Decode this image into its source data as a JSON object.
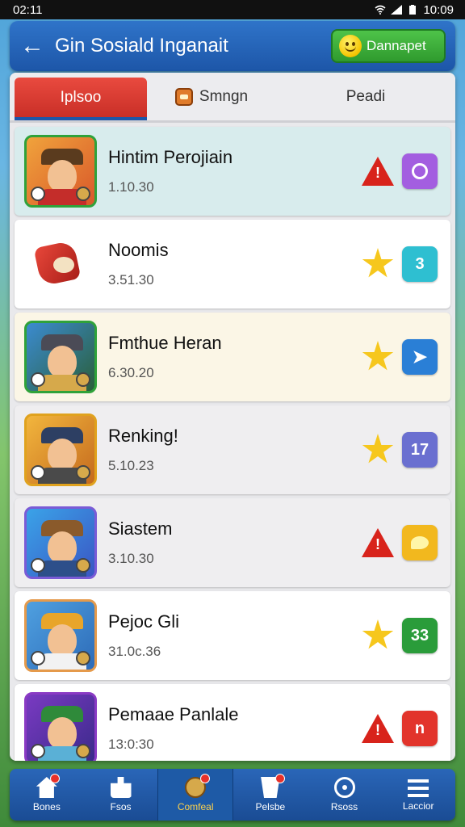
{
  "status_bar": {
    "time": "02:11",
    "clock": "10:09"
  },
  "header": {
    "title": "Gin Sosiald Inganait",
    "action_label": "Dannapet"
  },
  "tabs": [
    {
      "label": "Iplsoo"
    },
    {
      "label": "Smngn"
    },
    {
      "label": "Peadi"
    }
  ],
  "rows": [
    {
      "title": "Hintim Perojiain",
      "subtitle": "1.10.30",
      "indicator": "warning",
      "badge": "ring",
      "badge_text": ""
    },
    {
      "title": "Noomis",
      "subtitle": "3.51.30",
      "indicator": "star",
      "badge": "text",
      "badge_text": "3"
    },
    {
      "title": "Fmthue Heran",
      "subtitle": "6.30.20",
      "indicator": "star",
      "badge": "arrow",
      "badge_text": ""
    },
    {
      "title": "Renking!",
      "subtitle": "5.10.23",
      "indicator": "star",
      "badge": "text",
      "badge_text": "17"
    },
    {
      "title": "Siastem",
      "subtitle": "3.10.30",
      "indicator": "warning",
      "badge": "bubble",
      "badge_text": ""
    },
    {
      "title": "Pejoc Gli",
      "subtitle": "31.0c.36",
      "indicator": "star",
      "badge": "text",
      "badge_text": "33"
    },
    {
      "title": "Pemaae Panlale",
      "subtitle": "13:0:30",
      "indicator": "warning",
      "badge": "text",
      "badge_text": "n"
    }
  ],
  "nav": [
    {
      "label": "Bones"
    },
    {
      "label": "Fsos"
    },
    {
      "label": "Comfeal"
    },
    {
      "label": "Pelsbe"
    },
    {
      "label": "Rsoss"
    },
    {
      "label": "Laccior"
    }
  ],
  "colors": {
    "header_blue": "#1d56a8",
    "tab_active": "#d8342b",
    "action_green": "#3aae38",
    "nav_active_text": "#ffd24a"
  }
}
